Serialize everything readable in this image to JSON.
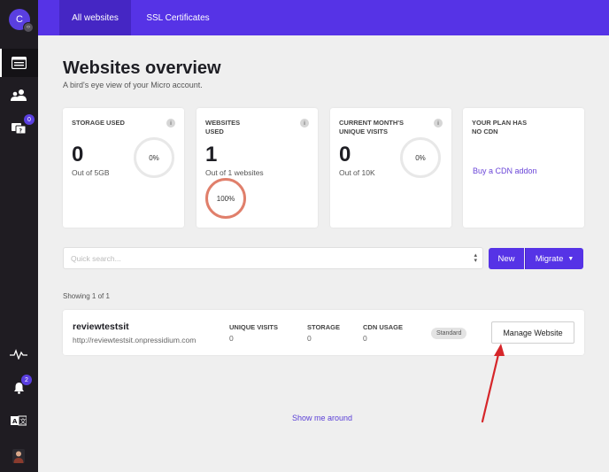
{
  "sidebar": {
    "avatar_letter": "C",
    "avatar_mini": "‹›",
    "items": [
      {
        "icon": "websites-icon"
      },
      {
        "icon": "users-icon"
      },
      {
        "icon": "support-icon",
        "badge": "0"
      },
      {
        "icon": "activity-icon"
      },
      {
        "icon": "bell-icon",
        "badge": "2"
      },
      {
        "icon": "translate-icon"
      },
      {
        "icon": "profile-avatar"
      }
    ]
  },
  "topnav": {
    "tabs": [
      {
        "label": "All websites",
        "active": true
      },
      {
        "label": "SSL Certificates",
        "active": false
      }
    ]
  },
  "header": {
    "title": "Websites overview",
    "subtitle": "A bird's eye view of your Micro account."
  },
  "cards": {
    "storage": {
      "label": "STORAGE USED",
      "value": "0",
      "out_of": "Out of 5GB",
      "percent": "0%"
    },
    "websites": {
      "label": "WEBSITES USED",
      "value": "1",
      "out_of": "Out of 1 websites",
      "percent": "100%"
    },
    "visits": {
      "label": "CURRENT MONTH'S UNIQUE VISITS",
      "value": "0",
      "out_of": "Out of 10K",
      "percent": "0%"
    },
    "plan": {
      "label": "YOUR PLAN HAS NO CDN",
      "link": "Buy a CDN addon"
    },
    "info_glyph": "i"
  },
  "search": {
    "placeholder": "Quick search...",
    "new_label": "New",
    "migrate_label": "Migrate"
  },
  "list": {
    "showing": "Showing 1 of 1",
    "sites": [
      {
        "name": "reviewtestsit",
        "url": "http://reviewtestsit.onpressidium.com",
        "unique_visits_label": "UNIQUE VISITS",
        "unique_visits": "0",
        "storage_label": "STORAGE",
        "storage": "0",
        "cdn_label": "CDN USAGE",
        "cdn": "0",
        "plan": "Standard",
        "manage_label": "Manage Website"
      }
    ]
  },
  "footer": {
    "show_around": "Show me around"
  },
  "colors": {
    "brand": "#5633e6",
    "ring_full": "#e07f6b",
    "annotation_arrow": "#d6262a"
  }
}
